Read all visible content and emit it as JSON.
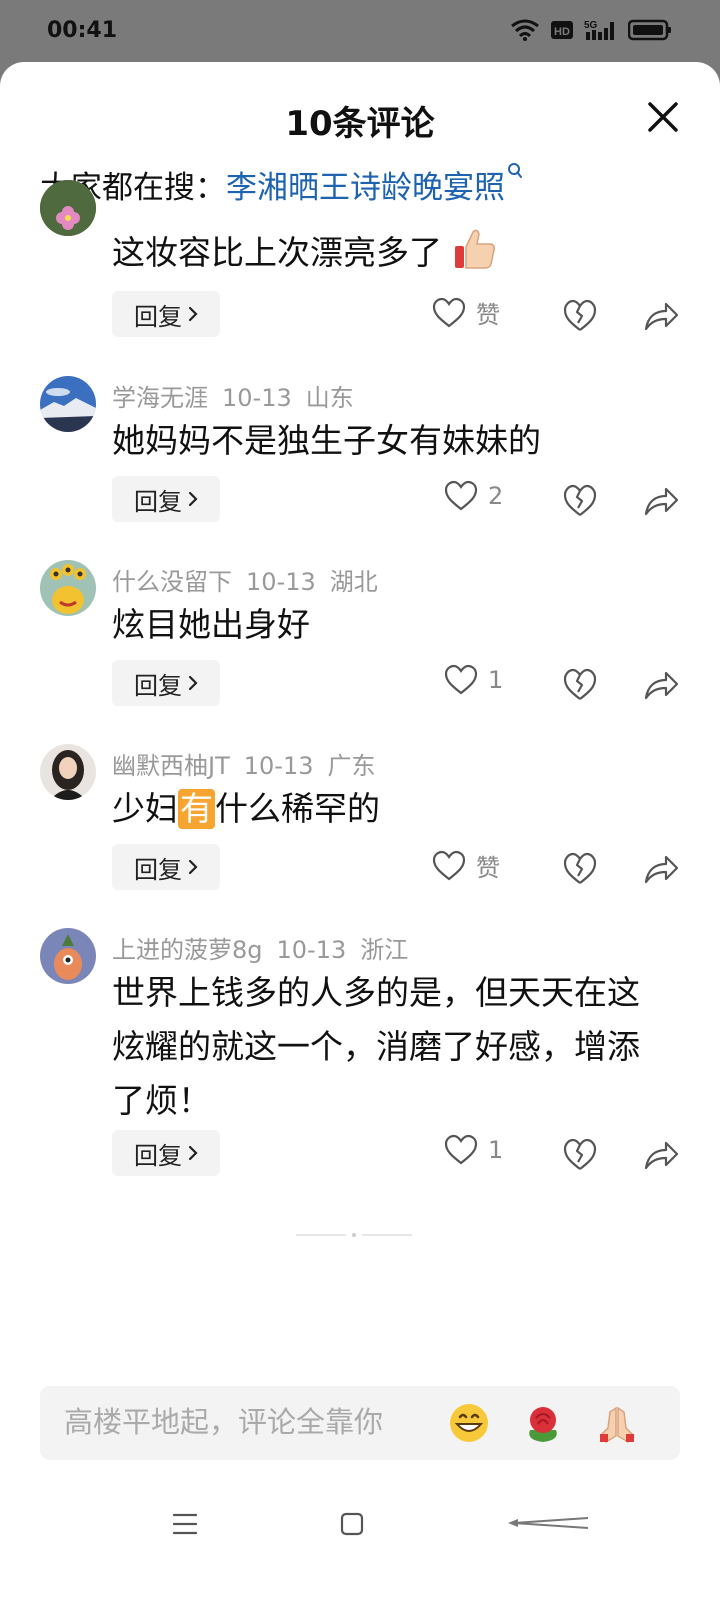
{
  "status": {
    "time": "00:41",
    "hd_label": "HD",
    "signal_label": "5G"
  },
  "header": {
    "title": "10条评论",
    "close_icon": "close-icon"
  },
  "hot_search": {
    "prefix": "大家都在搜：",
    "term": "李湘晒王诗龄晚宴照"
  },
  "comments": [
    {
      "text": "这妆容比上次漂亮多了",
      "emoji": "thumbs-up-icon",
      "reply": "回复",
      "likes": "赞"
    },
    {
      "user": "学海无涯",
      "date": "10-13",
      "location": "山东",
      "text": "她妈妈不是独生子女有妹妹的",
      "reply": "回复",
      "likes": "2"
    },
    {
      "user": "什么没留下",
      "date": "10-13",
      "location": "湖北",
      "text": "炫目她出身好",
      "reply": "回复",
      "likes": "1"
    },
    {
      "user": "幽默西柚JT",
      "date": "10-13",
      "location": "广东",
      "text_a": "少妇",
      "highlight": "有",
      "text_b": "什么稀罕的",
      "reply": "回复",
      "likes": "赞"
    },
    {
      "user": "上进的菠萝8g",
      "date": "10-13",
      "location": "浙江",
      "text": "世界上钱多的人多的是，但天天在这炫耀的就这一个，消磨了好感，增添了烦！",
      "reply": "回复",
      "likes": "1"
    }
  ],
  "composer": {
    "placeholder": "高楼平地起，评论全靠你",
    "emojis": [
      "grin-emoji",
      "rose-emoji",
      "pray-emoji"
    ]
  },
  "colors": {
    "link": "#1e63b0",
    "muted": "#999999",
    "highlight": "#f7a531",
    "status_bg": "#7a7a7a"
  }
}
